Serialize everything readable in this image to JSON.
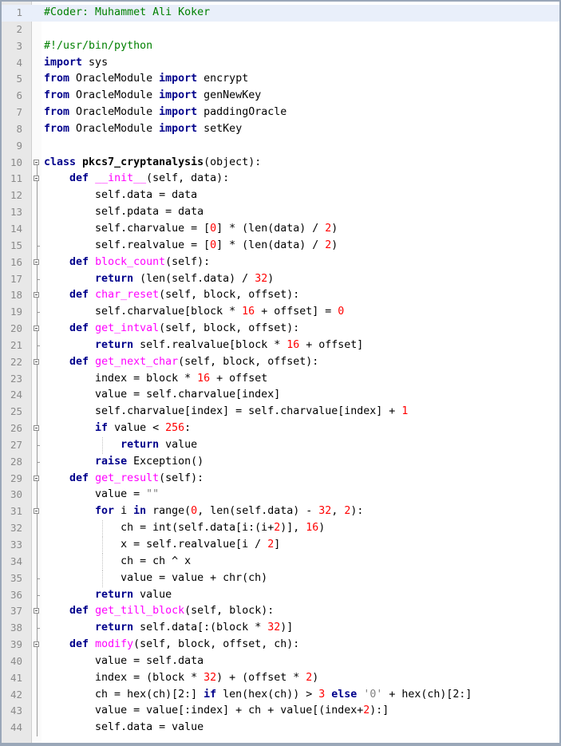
{
  "editor": {
    "colors": {
      "keyword": "#00008b",
      "function_name": "#ff00ff",
      "number": "#ff0000",
      "comment": "#008000",
      "string": "#808080",
      "current_line": "#e9effa",
      "gutter": "#e8e8e8"
    },
    "current_line": 1,
    "lines": [
      {
        "n": "1",
        "fold": "none",
        "seg": [
          {
            "t": "#Coder: Muhammet Ali Koker",
            "c": "cm"
          }
        ]
      },
      {
        "n": "2",
        "fold": "none",
        "seg": []
      },
      {
        "n": "3",
        "fold": "none",
        "seg": [
          {
            "t": "#!/usr/bin/python",
            "c": "cm"
          }
        ]
      },
      {
        "n": "4",
        "fold": "none",
        "seg": [
          {
            "t": "import",
            "c": "kw"
          },
          {
            "t": " sys"
          }
        ]
      },
      {
        "n": "5",
        "fold": "none",
        "seg": [
          {
            "t": "from",
            "c": "kw"
          },
          {
            "t": " OracleModule "
          },
          {
            "t": "import",
            "c": "kw"
          },
          {
            "t": " encrypt"
          }
        ]
      },
      {
        "n": "6",
        "fold": "none",
        "seg": [
          {
            "t": "from",
            "c": "kw"
          },
          {
            "t": " OracleModule "
          },
          {
            "t": "import",
            "c": "kw"
          },
          {
            "t": " genNewKey"
          }
        ]
      },
      {
        "n": "7",
        "fold": "none",
        "seg": [
          {
            "t": "from",
            "c": "kw"
          },
          {
            "t": " OracleModule "
          },
          {
            "t": "import",
            "c": "kw"
          },
          {
            "t": " paddingOracle"
          }
        ]
      },
      {
        "n": "8",
        "fold": "none",
        "seg": [
          {
            "t": "from",
            "c": "kw"
          },
          {
            "t": " OracleModule "
          },
          {
            "t": "import",
            "c": "kw"
          },
          {
            "t": " setKey"
          }
        ]
      },
      {
        "n": "9",
        "fold": "none",
        "seg": []
      },
      {
        "n": "10",
        "fold": "box",
        "seg": [
          {
            "t": "class",
            "c": "kw"
          },
          {
            "t": " "
          },
          {
            "t": "pkcs7_cryptanalysis",
            "c": "b"
          },
          {
            "t": "(object):"
          }
        ]
      },
      {
        "n": "11",
        "fold": "box",
        "seg": [
          {
            "t": "    "
          },
          {
            "t": "def",
            "c": "kw"
          },
          {
            "t": " "
          },
          {
            "t": "__init__",
            "c": "fn"
          },
          {
            "t": "(self, data):"
          }
        ]
      },
      {
        "n": "12",
        "fold": "line",
        "seg": [
          {
            "t": "        self.data = data"
          }
        ]
      },
      {
        "n": "13",
        "fold": "line",
        "seg": [
          {
            "t": "        self.pdata = data"
          }
        ]
      },
      {
        "n": "14",
        "fold": "line",
        "seg": [
          {
            "t": "        self.charvalue = ["
          },
          {
            "t": "0",
            "c": "num"
          },
          {
            "t": "] * (len(data) / "
          },
          {
            "t": "2",
            "c": "num"
          },
          {
            "t": ")"
          }
        ]
      },
      {
        "n": "15",
        "fold": "tick",
        "seg": [
          {
            "t": "        self.realvalue = ["
          },
          {
            "t": "0",
            "c": "num"
          },
          {
            "t": "] * (len(data) / "
          },
          {
            "t": "2",
            "c": "num"
          },
          {
            "t": ")"
          }
        ]
      },
      {
        "n": "16",
        "fold": "box",
        "seg": [
          {
            "t": "    "
          },
          {
            "t": "def",
            "c": "kw"
          },
          {
            "t": " "
          },
          {
            "t": "block_count",
            "c": "fn"
          },
          {
            "t": "(self):"
          }
        ]
      },
      {
        "n": "17",
        "fold": "tick",
        "seg": [
          {
            "t": "        "
          },
          {
            "t": "return",
            "c": "kw"
          },
          {
            "t": " (len(self.data) / "
          },
          {
            "t": "32",
            "c": "num"
          },
          {
            "t": ")"
          }
        ]
      },
      {
        "n": "18",
        "fold": "box",
        "seg": [
          {
            "t": "    "
          },
          {
            "t": "def",
            "c": "kw"
          },
          {
            "t": " "
          },
          {
            "t": "char_reset",
            "c": "fn"
          },
          {
            "t": "(self, block, offset):"
          }
        ]
      },
      {
        "n": "19",
        "fold": "tick",
        "seg": [
          {
            "t": "        self.charvalue[block * "
          },
          {
            "t": "16",
            "c": "num"
          },
          {
            "t": " + offset] = "
          },
          {
            "t": "0",
            "c": "num"
          }
        ]
      },
      {
        "n": "20",
        "fold": "box",
        "seg": [
          {
            "t": "    "
          },
          {
            "t": "def",
            "c": "kw"
          },
          {
            "t": " "
          },
          {
            "t": "get_intval",
            "c": "fn"
          },
          {
            "t": "(self, block, offset):"
          }
        ]
      },
      {
        "n": "21",
        "fold": "tick",
        "seg": [
          {
            "t": "        "
          },
          {
            "t": "return",
            "c": "kw"
          },
          {
            "t": " self.realvalue[block * "
          },
          {
            "t": "16",
            "c": "num"
          },
          {
            "t": " + offset]"
          }
        ]
      },
      {
        "n": "22",
        "fold": "box",
        "seg": [
          {
            "t": "    "
          },
          {
            "t": "def",
            "c": "kw"
          },
          {
            "t": " "
          },
          {
            "t": "get_next_char",
            "c": "fn"
          },
          {
            "t": "(self, block, offset):"
          }
        ]
      },
      {
        "n": "23",
        "fold": "line",
        "seg": [
          {
            "t": "        index = block * "
          },
          {
            "t": "16",
            "c": "num"
          },
          {
            "t": " + offset"
          }
        ]
      },
      {
        "n": "24",
        "fold": "line",
        "seg": [
          {
            "t": "        value = self.charvalue[index]"
          }
        ]
      },
      {
        "n": "25",
        "fold": "line",
        "seg": [
          {
            "t": "        self.charvalue[index] = self.charvalue[index] + "
          },
          {
            "t": "1",
            "c": "num"
          }
        ]
      },
      {
        "n": "26",
        "fold": "box",
        "seg": [
          {
            "t": "        "
          },
          {
            "t": "if",
            "c": "kw"
          },
          {
            "t": " value < "
          },
          {
            "t": "256",
            "c": "num"
          },
          {
            "t": ":"
          }
        ]
      },
      {
        "n": "27",
        "fold": "tick",
        "guide": true,
        "seg": [
          {
            "t": "            "
          },
          {
            "t": "return",
            "c": "kw"
          },
          {
            "t": " value"
          }
        ]
      },
      {
        "n": "28",
        "fold": "tick",
        "seg": [
          {
            "t": "        "
          },
          {
            "t": "raise",
            "c": "kw"
          },
          {
            "t": " Exception()"
          }
        ]
      },
      {
        "n": "29",
        "fold": "box",
        "seg": [
          {
            "t": "    "
          },
          {
            "t": "def",
            "c": "kw"
          },
          {
            "t": " "
          },
          {
            "t": "get_result",
            "c": "fn"
          },
          {
            "t": "(self):"
          }
        ]
      },
      {
        "n": "30",
        "fold": "line",
        "seg": [
          {
            "t": "        value = "
          },
          {
            "t": "\"\"",
            "c": "str"
          }
        ]
      },
      {
        "n": "31",
        "fold": "box",
        "seg": [
          {
            "t": "        "
          },
          {
            "t": "for",
            "c": "kw"
          },
          {
            "t": " i "
          },
          {
            "t": "in",
            "c": "kw"
          },
          {
            "t": " range("
          },
          {
            "t": "0",
            "c": "num"
          },
          {
            "t": ", len(self.data) - "
          },
          {
            "t": "32",
            "c": "num"
          },
          {
            "t": ", "
          },
          {
            "t": "2",
            "c": "num"
          },
          {
            "t": "):"
          }
        ]
      },
      {
        "n": "32",
        "fold": "line",
        "guide": true,
        "seg": [
          {
            "t": "            ch = int(self.data[i:(i+"
          },
          {
            "t": "2",
            "c": "num"
          },
          {
            "t": ")], "
          },
          {
            "t": "16",
            "c": "num"
          },
          {
            "t": ")"
          }
        ]
      },
      {
        "n": "33",
        "fold": "line",
        "guide": true,
        "seg": [
          {
            "t": "            x = self.realvalue[i / "
          },
          {
            "t": "2",
            "c": "num"
          },
          {
            "t": "]"
          }
        ]
      },
      {
        "n": "34",
        "fold": "line",
        "guide": true,
        "seg": [
          {
            "t": "            ch = ch ^ x"
          }
        ]
      },
      {
        "n": "35",
        "fold": "tick",
        "guide": true,
        "seg": [
          {
            "t": "            value = value + chr(ch)"
          }
        ]
      },
      {
        "n": "36",
        "fold": "tick",
        "seg": [
          {
            "t": "        "
          },
          {
            "t": "return",
            "c": "kw"
          },
          {
            "t": " value"
          }
        ]
      },
      {
        "n": "37",
        "fold": "box",
        "seg": [
          {
            "t": "    "
          },
          {
            "t": "def",
            "c": "kw"
          },
          {
            "t": " "
          },
          {
            "t": "get_till_block",
            "c": "fn"
          },
          {
            "t": "(self, block):"
          }
        ]
      },
      {
        "n": "38",
        "fold": "tick",
        "seg": [
          {
            "t": "        "
          },
          {
            "t": "return",
            "c": "kw"
          },
          {
            "t": " self.data[:(block * "
          },
          {
            "t": "32",
            "c": "num"
          },
          {
            "t": ")]"
          }
        ]
      },
      {
        "n": "39",
        "fold": "box",
        "seg": [
          {
            "t": "    "
          },
          {
            "t": "def",
            "c": "kw"
          },
          {
            "t": " "
          },
          {
            "t": "modify",
            "c": "fn"
          },
          {
            "t": "(self, block, offset, ch):"
          }
        ]
      },
      {
        "n": "40",
        "fold": "line",
        "seg": [
          {
            "t": "        value = self.data"
          }
        ]
      },
      {
        "n": "41",
        "fold": "line",
        "seg": [
          {
            "t": "        index = (block * "
          },
          {
            "t": "32",
            "c": "num"
          },
          {
            "t": ") + (offset * "
          },
          {
            "t": "2",
            "c": "num"
          },
          {
            "t": ")"
          }
        ]
      },
      {
        "n": "42",
        "fold": "line",
        "seg": [
          {
            "t": "        ch = hex(ch)[2:] "
          },
          {
            "t": "if",
            "c": "kw"
          },
          {
            "t": " len(hex(ch)) > "
          },
          {
            "t": "3",
            "c": "num"
          },
          {
            "t": " "
          },
          {
            "t": "else",
            "c": "kw"
          },
          {
            "t": " "
          },
          {
            "t": "'0'",
            "c": "str"
          },
          {
            "t": " + hex(ch)[2:]"
          }
        ]
      },
      {
        "n": "43",
        "fold": "line",
        "seg": [
          {
            "t": "        value = value[:index] + ch + value[(index+"
          },
          {
            "t": "2",
            "c": "num"
          },
          {
            "t": "):]"
          }
        ]
      },
      {
        "n": "44",
        "fold": "line",
        "seg": [
          {
            "t": "        self.data = value"
          }
        ]
      }
    ]
  }
}
